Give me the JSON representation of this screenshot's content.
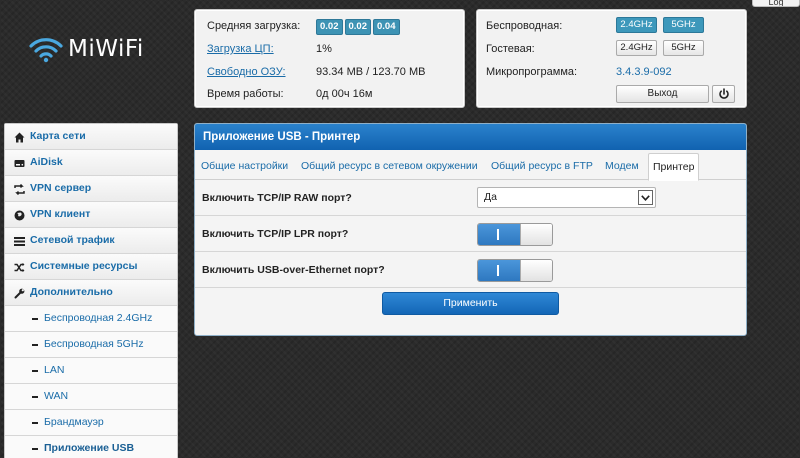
{
  "log_tab": "Log",
  "logo": {
    "text": "MiWiFi",
    "icon": "wifi-icon"
  },
  "status_left": {
    "load_label": "Средняя загрузка:",
    "load_values": [
      "0.02",
      "0.02",
      "0.04"
    ],
    "cpu_label": "Загрузка ЦП:",
    "cpu_value": "1%",
    "ram_label": "Свободно ОЗУ:",
    "ram_value": "93.34 MB / 123.70 MB",
    "uptime_label": "Время работы:",
    "uptime_value": "0д 00ч 16м"
  },
  "status_right": {
    "wireless_label": "Беспроводная:",
    "guest_label": "Гостевая:",
    "bands": [
      "2.4GHz",
      "5GHz"
    ],
    "firmware_label": "Микропрограмма:",
    "firmware_value": "3.4.3.9-092",
    "logout_label": "Выход",
    "power_icon": "power-icon"
  },
  "sidebar": {
    "items": [
      {
        "label": "Карта сети",
        "icon": "home-icon"
      },
      {
        "label": "AiDisk",
        "icon": "disk-icon"
      },
      {
        "label": "VPN сервер",
        "icon": "vpn-server-icon"
      },
      {
        "label": "VPN клиент",
        "icon": "globe-icon"
      },
      {
        "label": "Сетевой трафик",
        "icon": "traffic-icon"
      },
      {
        "label": "Системные ресурсы",
        "icon": "shuffle-icon"
      },
      {
        "label": "Дополнительно",
        "icon": "wrench-icon"
      }
    ],
    "subitems": [
      {
        "label": "Беспроводная 2.4GHz"
      },
      {
        "label": "Беспроводная 5GHz"
      },
      {
        "label": "LAN"
      },
      {
        "label": "WAN"
      },
      {
        "label": "Брандмауэр"
      },
      {
        "label": "Приложение USB"
      }
    ]
  },
  "main": {
    "title": "Приложение USB - Принтер",
    "tabs": [
      {
        "label": "Общие настройки"
      },
      {
        "label": "Общий ресурс в сетевом окружении"
      },
      {
        "label": "Общий ресурс в FTP"
      },
      {
        "label": "Модем"
      },
      {
        "label": "Принтер"
      }
    ],
    "fields": {
      "raw_label": "Включить TCP/IP RAW порт?",
      "raw_value": "Да",
      "lpr_label": "Включить TCP/IP LPR порт?",
      "lpr_on": true,
      "usb_label": "Включить USB-over-Ethernet порт?",
      "usb_on": true
    },
    "apply_label": "Применить"
  },
  "colors": {
    "header_blue": "#1866b4",
    "link_blue": "#1a6ca8",
    "badge": "#3d93b4"
  }
}
